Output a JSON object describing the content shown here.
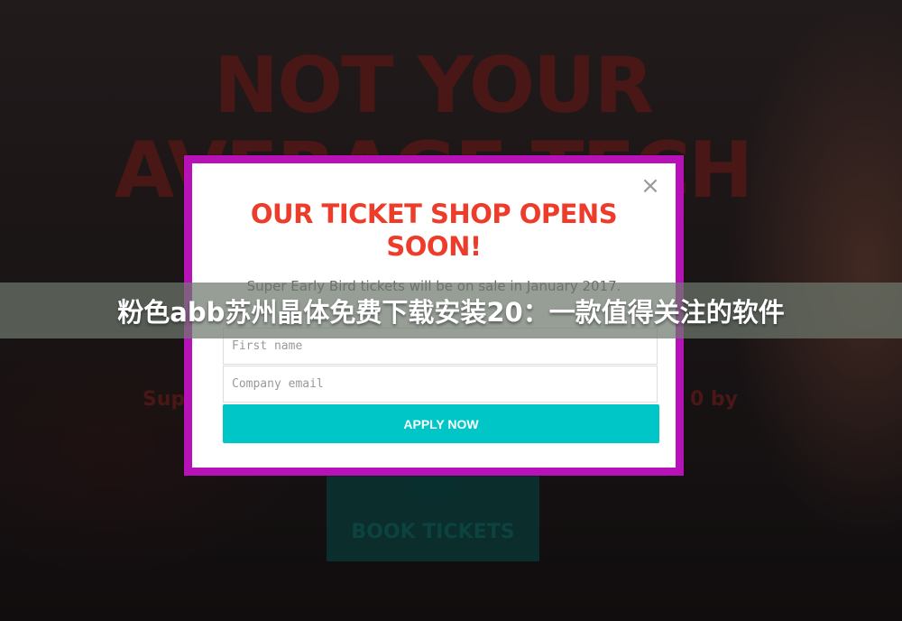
{
  "background": {
    "hero_line1": "NOT YOUR",
    "hero_line2": "AVERAGE TECH",
    "hero_sub_left": "Sup",
    "hero_sub_right": "0 by",
    "book_label": "BOOK TICKETS",
    "accent_color": "#5a1d1a"
  },
  "modal": {
    "title_line1": "OUR TICKET SHOP OPENS",
    "title_line2": "SOON!",
    "subtitle": "Super Early Bird tickets will be on sale in January 2017.",
    "first_name_placeholder": "First name",
    "email_placeholder": "Company email",
    "apply_label": "APPLY NOW",
    "close_glyph": "×",
    "border_color": "#b612b8",
    "button_color": "#00c6c8",
    "title_color": "#ee3c2a"
  },
  "banner": {
    "text": "粉色abb苏州晶体免费下载安装20：一款值得关注的软件"
  }
}
